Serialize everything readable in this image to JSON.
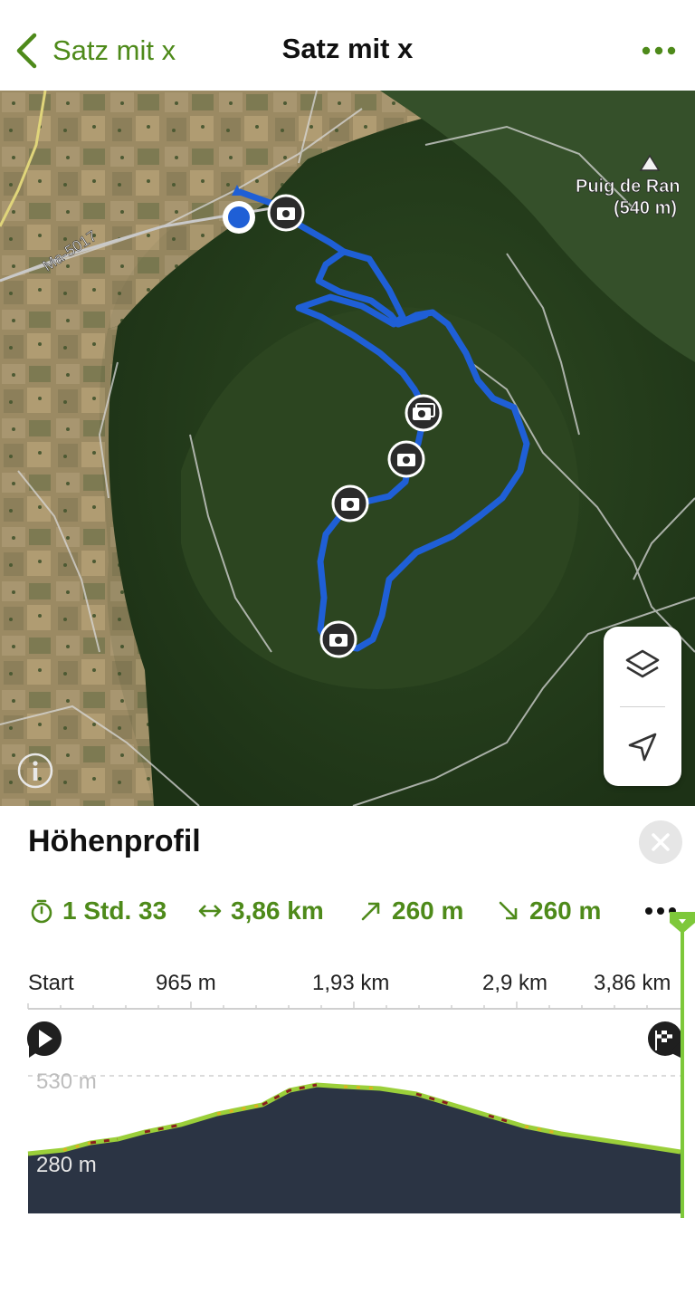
{
  "header": {
    "back_label": "Satz mit x",
    "title": "Satz mit x"
  },
  "map": {
    "labels": {
      "road": "Ma-5017",
      "peak_name": "Puig de Ran",
      "peak_elevation": "(540 m)"
    }
  },
  "panel": {
    "title": "Höhenprofil",
    "stats": {
      "duration": "1 Std. 33",
      "distance": "3,86 km",
      "ascent": "260 m",
      "descent": "260 m"
    },
    "axis": {
      "start": "Start",
      "tick1": "965 m",
      "tick2": "1,93 km",
      "tick3": "2,9 km",
      "end": "3,86 km"
    },
    "elevation": {
      "max_label": "530 m",
      "min_label": "280 m"
    }
  },
  "colors": {
    "accent": "#4e8a1a",
    "route": "#1f5fd6",
    "profile_fill": "#2b3444"
  }
}
